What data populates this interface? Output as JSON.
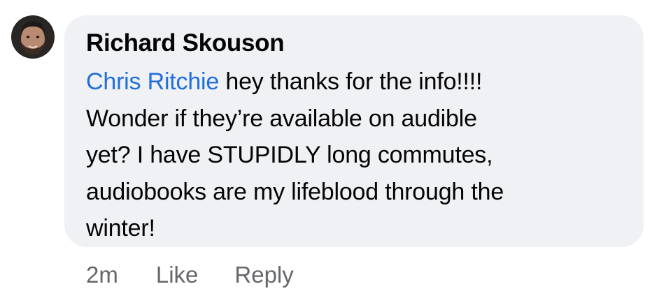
{
  "comment": {
    "author": "Richard Skouson",
    "mention": "Chris Ritchie",
    "text_line1": " hey thanks for the info!!!!",
    "text_rest": "Wonder if they’re available on audible\nyet?  I have STUPIDLY long commutes,\naudiobooks are my lifeblood through the\nwinter!",
    "timestamp": "2m",
    "like_label": "Like",
    "reply_label": "Reply"
  },
  "colors": {
    "bubble": "#f0f1f5",
    "mention": "#216fdb",
    "meta_text": "#65676b",
    "text": "#050505"
  },
  "icons": {
    "avatar": "user-avatar-photo"
  }
}
